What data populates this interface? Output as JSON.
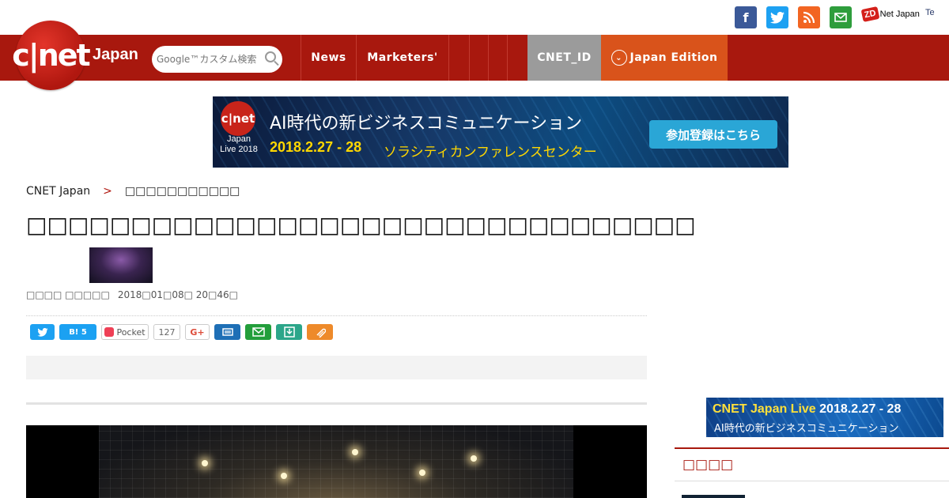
{
  "social": [
    {
      "name": "facebook",
      "glyph": "f",
      "color": "#3b5998"
    },
    {
      "name": "twitter",
      "glyph": "t",
      "color": "#1da1f2"
    },
    {
      "name": "rss",
      "glyph": ")",
      "color": "#f26522"
    },
    {
      "name": "mail",
      "glyph": "✉",
      "color": "#2e9d3c"
    }
  ],
  "partner_sites": {
    "zdnet_mark": "ZD",
    "zdnet_label": "Net Japan",
    "tech_label": "Te"
  },
  "logo": {
    "text": "c|net",
    "suffix": "Japan"
  },
  "search": {
    "placeholder": "Google™カスタム検索"
  },
  "nav": {
    "items": [
      "News",
      "Marketers'"
    ],
    "cnet_id": "CNET_ID",
    "edition": "Japan Edition"
  },
  "banner": {
    "logo_text": "c|net",
    "logo_sub": "Japan Live 2018",
    "title": "AI時代の新ビジネスコミュニケーション",
    "date": "2018.2.27 - 28",
    "venue": "ソラシティカンファレンスセンター",
    "cta": "参加登録はこちら"
  },
  "breadcrumb": {
    "home": "CNET Japan",
    "separator": ">",
    "section": "□□□□□□□□□□□"
  },
  "article": {
    "headline": "□□□□□□□□□□□□□□□□□□□□□□□□□□□□□□□□",
    "author": "□□□□ □□□□□",
    "date": "2018□01□08□ 20□46□"
  },
  "share": {
    "hatena": "B! 5",
    "pocket": "Pocket",
    "pocket_count": "127",
    "gplus": "G+"
  },
  "sidebar": {
    "ad_line1_event": "CNET Japan Live",
    "ad_line1_date": "2018.2.27 - 28",
    "ad_line2": "AI時代の新ビジネスコミュニケーション",
    "section_title": "□□□□"
  },
  "colors": {
    "brand_red": "#a8180e",
    "edition_orange": "#d9531b",
    "cnet_id_gray": "#9b9b9b"
  }
}
